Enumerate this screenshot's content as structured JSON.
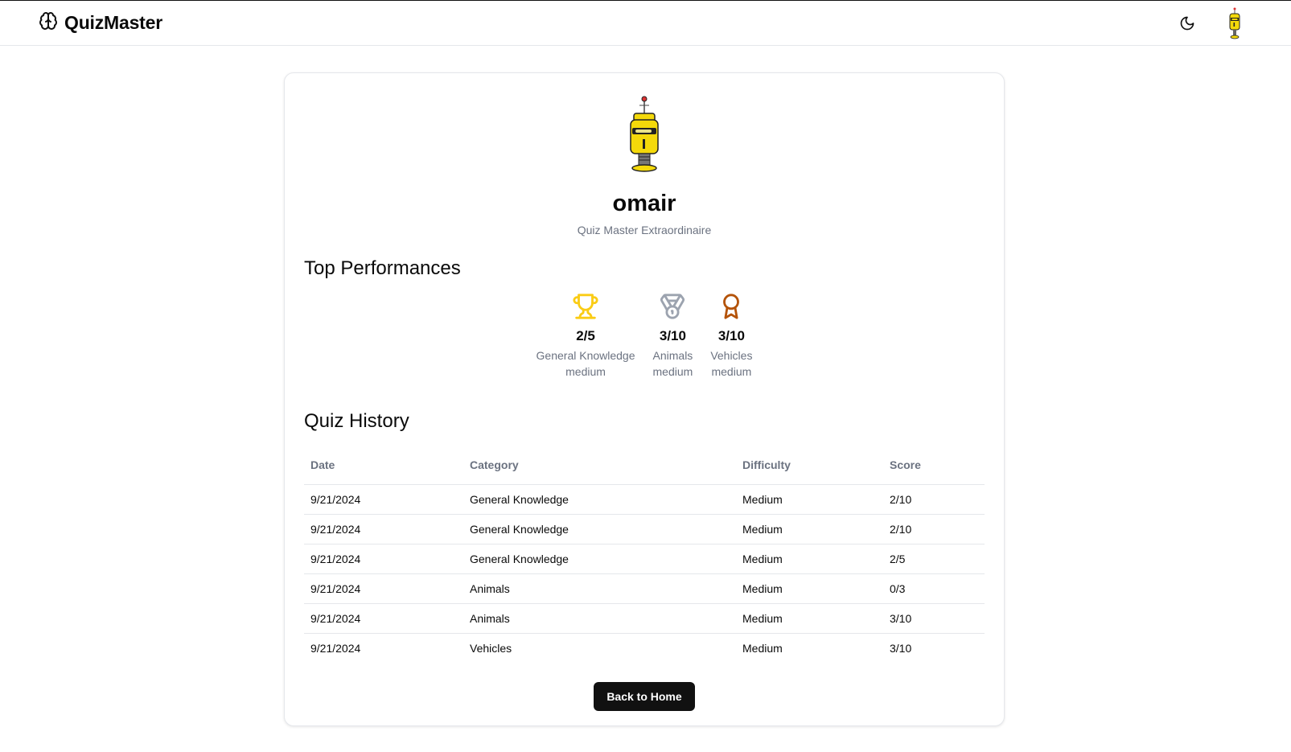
{
  "header": {
    "title": "QuizMaster",
    "logo_icon": "brain-icon",
    "theme_icon": "moon-icon",
    "avatar_icon": "robot-avatar"
  },
  "profile": {
    "username": "omair",
    "subtitle": "Quiz Master Extraordinaire"
  },
  "top_performances": {
    "title": "Top Performances",
    "items": [
      {
        "icon": "trophy-icon",
        "color": "#facc15",
        "score": "2/5",
        "category": "General Knowledge",
        "difficulty": "medium"
      },
      {
        "icon": "medal-icon",
        "color": "#9ca3af",
        "score": "3/10",
        "category": "Animals",
        "difficulty": "medium"
      },
      {
        "icon": "award-icon",
        "color": "#b45309",
        "score": "3/10",
        "category": "Vehicles",
        "difficulty": "medium"
      }
    ]
  },
  "history": {
    "title": "Quiz History",
    "columns": [
      "Date",
      "Category",
      "Difficulty",
      "Score"
    ],
    "rows": [
      [
        "9/21/2024",
        "General Knowledge",
        "Medium",
        "2/10"
      ],
      [
        "9/21/2024",
        "General Knowledge",
        "Medium",
        "2/10"
      ],
      [
        "9/21/2024",
        "General Knowledge",
        "Medium",
        "2/5"
      ],
      [
        "9/21/2024",
        "Animals",
        "Medium",
        "0/3"
      ],
      [
        "9/21/2024",
        "Animals",
        "Medium",
        "3/10"
      ],
      [
        "9/21/2024",
        "Vehicles",
        "Medium",
        "3/10"
      ]
    ]
  },
  "back_button": "Back to Home"
}
